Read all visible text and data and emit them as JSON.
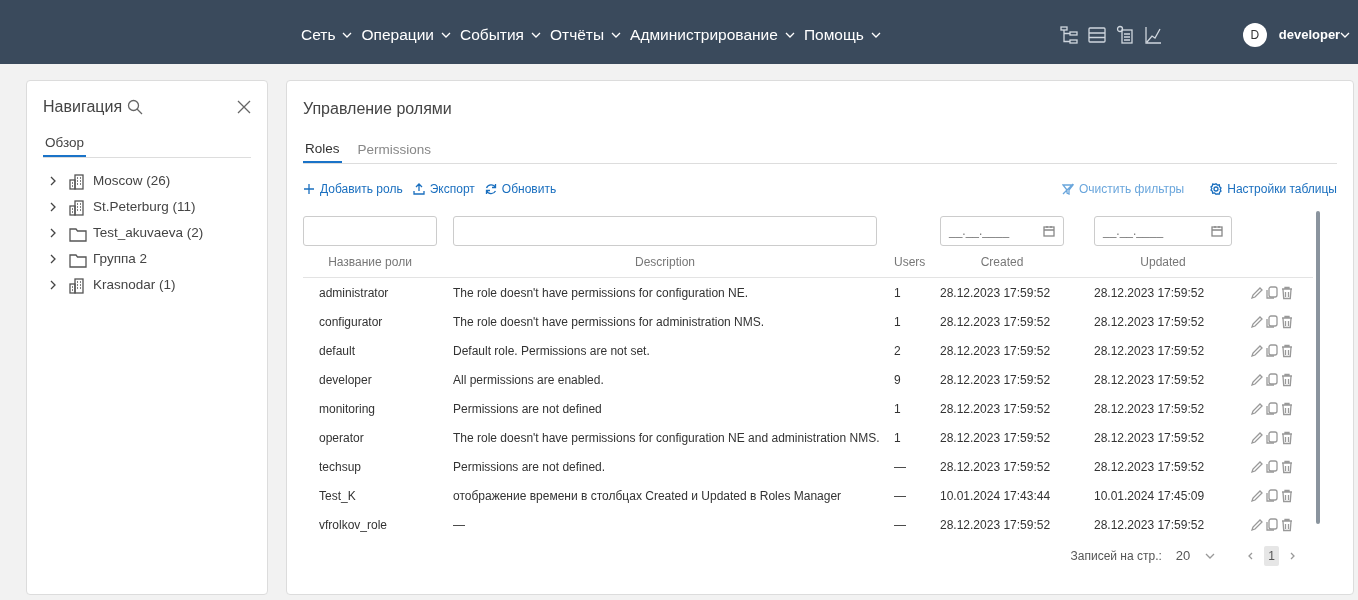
{
  "top_menu": [
    {
      "label": "Сеть"
    },
    {
      "label": "Операции"
    },
    {
      "label": "События"
    },
    {
      "label": "Отчёты"
    },
    {
      "label": "Администрирование"
    },
    {
      "label": "Помощь"
    }
  ],
  "user": {
    "initial": "D",
    "name": "developer"
  },
  "navigation": {
    "title": "Навигация",
    "tabs": [
      {
        "label": "Обзор",
        "selected": true
      }
    ],
    "tree": [
      {
        "label": "Moscow (26)",
        "kind": "building",
        "expanded": false
      },
      {
        "label": "St.Peterburg (11)",
        "kind": "building",
        "expanded": false
      },
      {
        "label": "Test_akuvaeva (2)",
        "kind": "folder",
        "expanded": false
      },
      {
        "label": "Группа 2",
        "kind": "folder",
        "expanded": false
      },
      {
        "label": "Krasnodar (1)",
        "kind": "building",
        "expanded": false
      }
    ]
  },
  "main": {
    "title": "Управление ролями",
    "tabs": [
      {
        "label": "Roles",
        "selected": true
      },
      {
        "label": "Permissions",
        "selected": false
      }
    ],
    "actions": [
      {
        "label": "Добавить роль",
        "kind": "add",
        "disabled": false
      },
      {
        "label": "Экспорт",
        "kind": "export",
        "disabled": false
      },
      {
        "label": "Обновить",
        "kind": "refresh",
        "disabled": false
      }
    ],
    "right_actions": [
      {
        "label": "Очистить фильтры",
        "kind": "clear",
        "disabled": true
      },
      {
        "label": "Настройки таблицы",
        "kind": "settings",
        "disabled": false
      }
    ],
    "table": {
      "columns": [
        {
          "label": "Название роли",
          "kind": "text"
        },
        {
          "label": "Description",
          "kind": "text"
        },
        {
          "label": "Users",
          "kind": "plain"
        },
        {
          "label": "Created",
          "kind": "date",
          "placeholder": "__.__.____"
        },
        {
          "label": "Updated",
          "kind": "date",
          "placeholder": "__.__.____"
        }
      ],
      "rows": [
        {
          "name": "administrator",
          "description": "The role doesn't have permissions for configuration NE.",
          "users": "1",
          "created": "28.12.2023 17:59:52",
          "updated": "28.12.2023 17:59:52"
        },
        {
          "name": "configurator",
          "description": "The role doesn't have permissions for administration NMS.",
          "users": "1",
          "created": "28.12.2023 17:59:52",
          "updated": "28.12.2023 17:59:52"
        },
        {
          "name": "default",
          "description": "Default role. Permissions are not set.",
          "users": "2",
          "created": "28.12.2023 17:59:52",
          "updated": "28.12.2023 17:59:52"
        },
        {
          "name": "developer",
          "description": "All permissions are enabled.",
          "users": "9",
          "created": "28.12.2023 17:59:52",
          "updated": "28.12.2023 17:59:52"
        },
        {
          "name": "monitoring",
          "description": "Permissions are not defined",
          "users": "1",
          "created": "28.12.2023 17:59:52",
          "updated": "28.12.2023 17:59:52"
        },
        {
          "name": "operator",
          "description": "The role doesn't have permissions for configuration NE and administration NMS.",
          "users": "1",
          "created": "28.12.2023 17:59:52",
          "updated": "28.12.2023 17:59:52"
        },
        {
          "name": "techsup",
          "description": "Permissions are not defined.",
          "users": "—",
          "created": "28.12.2023 17:59:52",
          "updated": "28.12.2023 17:59:52"
        },
        {
          "name": "Test_K",
          "description": "отображение времени в столбцах Created и Updated в Roles Manager",
          "users": "—",
          "created": "10.01.2024 17:43:44",
          "updated": "10.01.2024 17:45:09"
        },
        {
          "name": "vfrolkov_role",
          "description": "—",
          "users": "—",
          "created": "28.12.2023 17:59:52",
          "updated": "28.12.2023 17:59:52"
        }
      ]
    },
    "pagination": {
      "label": "Записей на стр.:",
      "page_size": "20",
      "pages": [
        {
          "label": "1",
          "selected": true
        }
      ]
    }
  }
}
